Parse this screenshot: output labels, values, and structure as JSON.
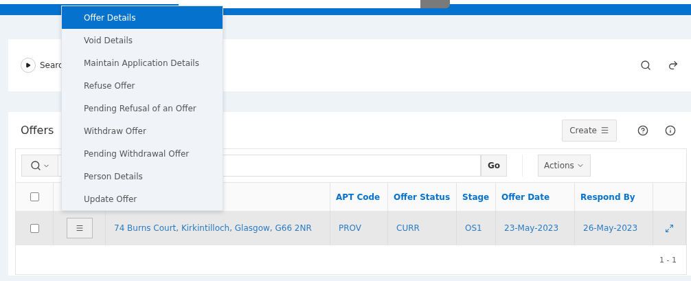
{
  "search_region": {
    "toggle_label": "Searc"
  },
  "offers": {
    "title": "Offers",
    "create_label": "Create",
    "go_label": "Go",
    "actions_label": "Actions",
    "select_all_checked": false,
    "columns": [
      {
        "kind": "blank"
      },
      {
        "kind": "text",
        "label": "APT Code"
      },
      {
        "kind": "text",
        "label": "Offer Status"
      },
      {
        "kind": "text",
        "label": "Stage"
      },
      {
        "kind": "text",
        "label": "Offer Date"
      },
      {
        "kind": "text",
        "label": "Respond By"
      }
    ],
    "rows": [
      {
        "checked": false,
        "cells": [
          "74 Burns Court, Kirkintilloch, Glasgow, G66 2NR",
          "PROV",
          "CURR",
          "OS1",
          "23-May-2023",
          "26-May-2023"
        ]
      }
    ],
    "pagination": "1 - 1"
  },
  "row_menu": {
    "items": [
      {
        "label": "Offer Details",
        "selected": true
      },
      {
        "label": "Void Details",
        "selected": false
      },
      {
        "label": "Maintain Application Details",
        "selected": false
      },
      {
        "label": "Refuse Offer",
        "selected": false
      },
      {
        "label": "Pending Refusal of an Offer",
        "selected": false
      },
      {
        "label": "Withdraw Offer",
        "selected": false
      },
      {
        "label": "Pending Withdrawal Offer",
        "selected": false
      },
      {
        "label": "Person Details",
        "selected": false
      },
      {
        "label": "Update Offer",
        "selected": false
      }
    ]
  }
}
